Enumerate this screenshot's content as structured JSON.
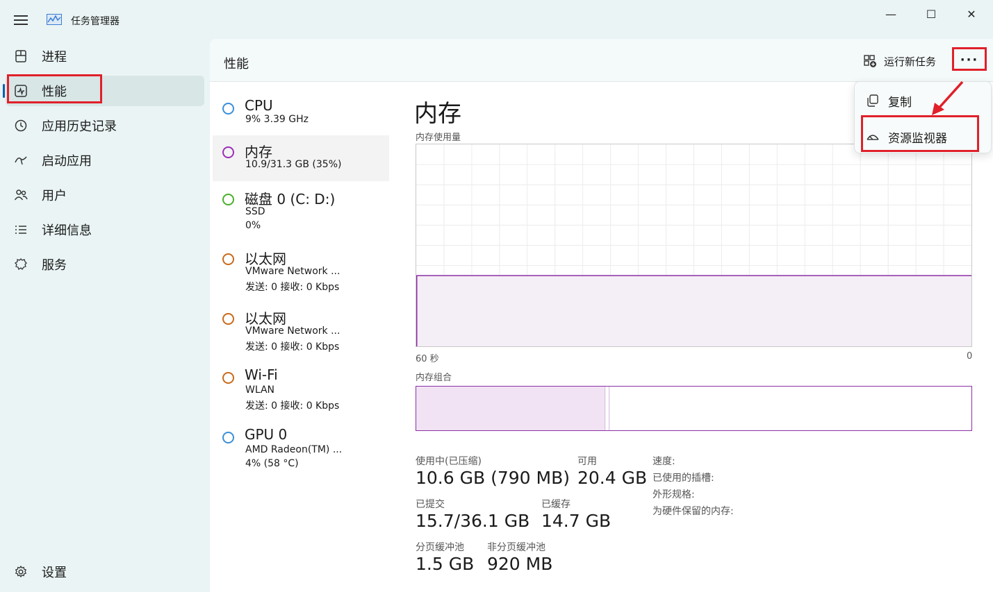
{
  "app": {
    "title": "任务管理器"
  },
  "window": {
    "minimize": "—",
    "maximize": "☐",
    "close": "✕"
  },
  "sidebar": {
    "items": [
      {
        "label": "进程",
        "icon": "processes-icon"
      },
      {
        "label": "性能",
        "icon": "performance-icon",
        "active": true
      },
      {
        "label": "应用历史记录",
        "icon": "history-icon"
      },
      {
        "label": "启动应用",
        "icon": "startup-icon"
      },
      {
        "label": "用户",
        "icon": "users-icon"
      },
      {
        "label": "详细信息",
        "icon": "details-icon"
      },
      {
        "label": "服务",
        "icon": "services-icon"
      }
    ],
    "settings": "设置"
  },
  "header": {
    "title": "性能",
    "run_task": "运行新任务",
    "more": "···"
  },
  "devices": [
    {
      "name": "CPU",
      "line1": "9%  3.39 GHz",
      "line2": "",
      "color": "#3a8fd8"
    },
    {
      "name": "内存",
      "line1": "10.9/31.3 GB (35%)",
      "line2": "",
      "color": "#9b2fb8"
    },
    {
      "name": "磁盘 0 (C: D:)",
      "line1": "SSD",
      "line2": "0%",
      "color": "#4caf2a"
    },
    {
      "name": "以太网",
      "line1": "VMware Network ...",
      "line2": "发送: 0  接收: 0 Kbps",
      "color": "#c86a1c"
    },
    {
      "name": "以太网",
      "line1": "VMware Network ...",
      "line2": "发送: 0  接收: 0 Kbps",
      "color": "#c86a1c"
    },
    {
      "name": "Wi-Fi",
      "line1": "WLAN",
      "line2": "发送: 0  接收: 0 Kbps",
      "color": "#c86a1c"
    },
    {
      "name": "GPU 0",
      "line1": "AMD Radeon(TM) ...",
      "line2": "4%  (58 °C)",
      "color": "#3a8fd8"
    }
  ],
  "memory": {
    "title": "内存",
    "usage_label": "内存使用量",
    "time_left": "60 秒",
    "time_right": "0",
    "usage_fraction": 0.35,
    "composition_label": "内存组合",
    "in_use_fraction": 0.34,
    "stats": {
      "in_use_label": "使用中(已压缩)",
      "in_use_value": "10.6 GB (790 MB)",
      "available_label": "可用",
      "available_value": "20.4 GB",
      "committed_label": "已提交",
      "committed_value": "15.7/36.1 GB",
      "cached_label": "已缓存",
      "cached_value": "14.7 GB",
      "paged_label": "分页缓冲池",
      "paged_value": "1.5 GB",
      "nonpaged_label": "非分页缓冲池",
      "nonpaged_value": "920 MB"
    },
    "specs": {
      "speed": "速度:",
      "slots": "已使用的插槽:",
      "form": "外形规格:",
      "reserved": "为硬件保留的内存:"
    }
  },
  "popup": {
    "copy": "复制",
    "resource_monitor": "资源监视器"
  },
  "colors": {
    "accent": "#0a5fb4",
    "memory": "#8b2fa5",
    "highlight": "#e0202a"
  }
}
